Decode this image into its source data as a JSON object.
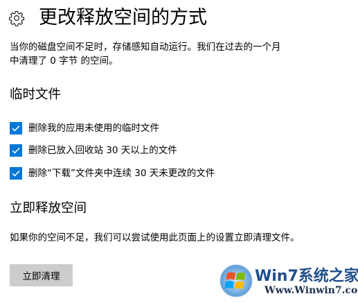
{
  "header": {
    "icon": "gear-icon",
    "title": "更改释放空间的方式"
  },
  "description": {
    "line1": "当你的磁盘空间不足时，存储感知自动运行。我们在过去的一个月",
    "line2": "中清理了 0 字节 的空间。"
  },
  "temp_files": {
    "heading": "临时文件",
    "items": [
      {
        "label": "删除我的应用未使用的临时文件",
        "checked": true
      },
      {
        "label": "删除已放入回收站 30 天以上的文件",
        "checked": true
      },
      {
        "label": "删除“下载”文件夹中连续 30 天未更改的文件",
        "checked": true
      }
    ]
  },
  "free_now": {
    "heading": "立即释放空间",
    "description": "如果你的空间不足，我们可以尝试使用此页面上的设置立即清理文件。",
    "button_label": "立即清理"
  },
  "watermark": {
    "brand": "Win7系统之家",
    "url": "Www.Winwin7.com"
  },
  "colors": {
    "accent": "#0078d7",
    "button_bg": "#cccccc",
    "text": "#000000"
  }
}
